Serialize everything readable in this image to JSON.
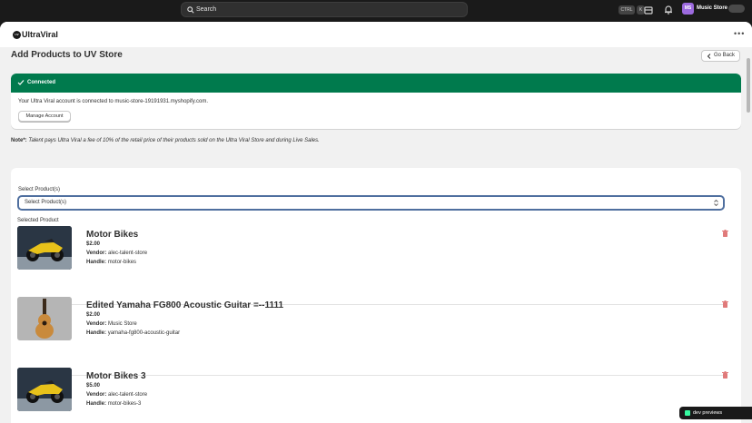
{
  "topbar": {
    "search_placeholder": "Search",
    "shortcut_keys": [
      "CTRL",
      "K"
    ],
    "store_initials": "MS",
    "store_name": "Music Store"
  },
  "app": {
    "logo_text": "UltraViral",
    "logo_mark": "UV"
  },
  "page": {
    "title": "Add Products to UV Store",
    "go_back_label": "Go Back"
  },
  "connection": {
    "status": "Connected",
    "message": "Your Ultra Viral account is connected to music-store-19191931.myshopify.com.",
    "manage_label": "Manage Account",
    "accent": "#007a4d"
  },
  "note": {
    "prefix": "Note*:",
    "text": "Talent pays Ultra Viral a fee of 10% of the retail price of their products sold on the Ultra Viral Store and during Live Sales."
  },
  "selector": {
    "label": "Select Product(s)",
    "value": "Select Product(s)",
    "selected_heading": "Selected Product"
  },
  "products": [
    {
      "name": "Motor Bikes",
      "price": "$2.00",
      "vendor_label": "Vendor:",
      "vendor": "alec-talent-store",
      "handle_label": "Handle:",
      "handle": "motor-bikes",
      "image": "motorbike"
    },
    {
      "name": "Edited Yamaha FG800 Acoustic Guitar =--1111",
      "price": "$2.00",
      "vendor_label": "Vendor:",
      "vendor": "Music Store",
      "handle_label": "Handle:",
      "handle": "yamaha-fg800-acoustic-guitar",
      "image": "guitar"
    },
    {
      "name": "Motor Bikes 3",
      "price": "$5.00",
      "vendor_label": "Vendor:",
      "vendor": "alec-talent-store",
      "handle_label": "Handle:",
      "handle": "motor-bikes-3",
      "image": "motorbike"
    }
  ],
  "dev_badge": "dev previews"
}
